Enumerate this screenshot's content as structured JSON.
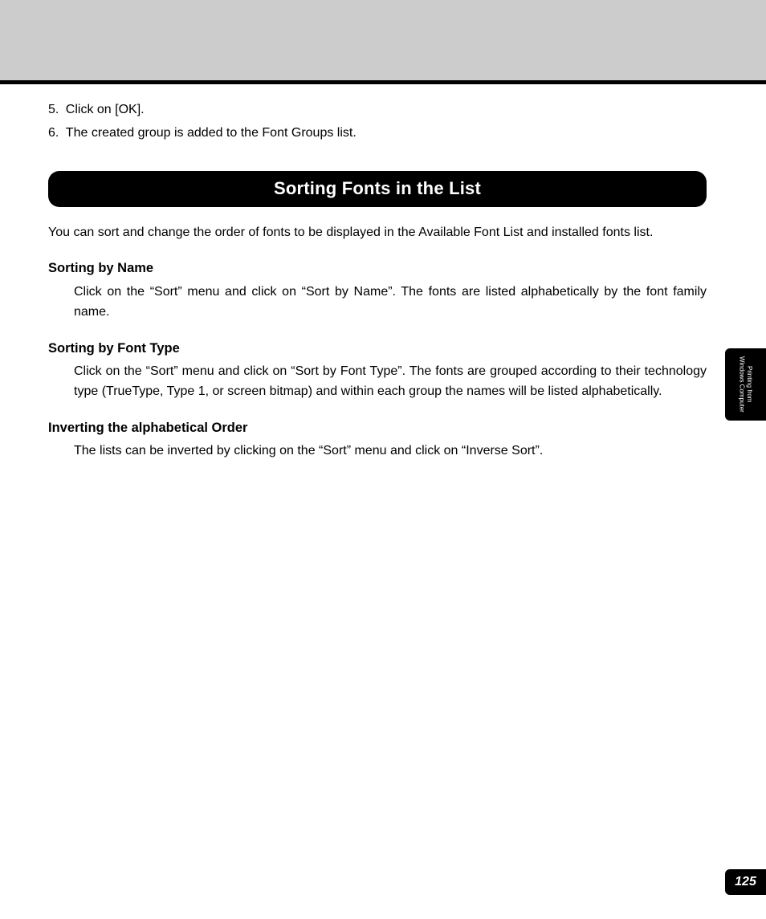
{
  "steps": [
    {
      "num": "5.",
      "text": "Click on [OK]."
    },
    {
      "num": "6.",
      "text": "The created group is added to the Font Groups list."
    }
  ],
  "section_title": "Sorting Fonts in the List",
  "intro": "You can sort and change the order of fonts to be displayed in the Available Font List and installed fonts list.",
  "subsections": [
    {
      "head": "Sorting by Name",
      "body": "Click on the “Sort” menu and click on “Sort by Name”. The fonts are listed alphabetically by the font family name."
    },
    {
      "head": "Sorting by Font Type",
      "body": "Click on the “Sort” menu and click on “Sort by Font Type”. The fonts are grouped according to their technology type (TrueType, Type 1, or screen bitmap) and within each group the names will be listed alphabetically."
    },
    {
      "head": "Inverting the alphabetical Order",
      "body": "The lists can be inverted by clicking on the “Sort” menu and click on “Inverse Sort”."
    }
  ],
  "side_tab": "Printing from\nWindows Computer",
  "page_number": "125"
}
